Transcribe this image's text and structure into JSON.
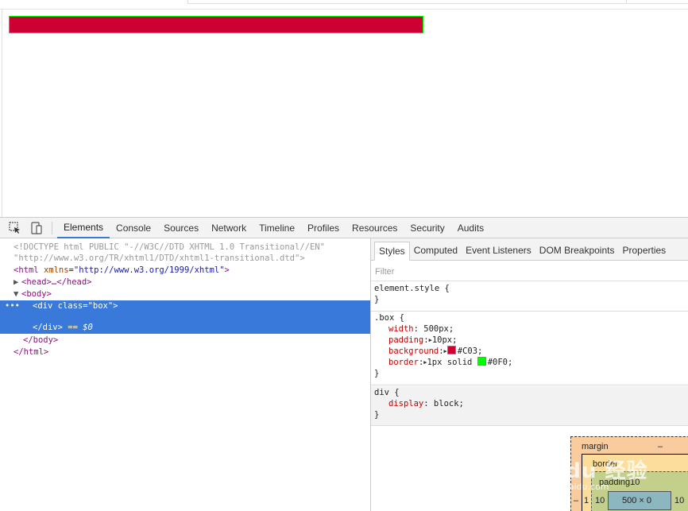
{
  "devtools": {
    "tabs": [
      "Elements",
      "Console",
      "Sources",
      "Network",
      "Timeline",
      "Profiles",
      "Resources",
      "Security",
      "Audits"
    ],
    "active_tab": "Elements",
    "icons": [
      "inspect-element-icon",
      "device-mode-icon"
    ]
  },
  "demo": {
    "box_background": "#cc0033",
    "box_border": "#00ff00"
  },
  "elements": {
    "doctype_1": "<!DOCTYPE html PUBLIC \"-//W3C//DTD XHTML 1.0 Transitional//EN\"",
    "doctype_2": "\"http://www.w3.org/TR/xhtml1/DTD/xhtml1-transitional.dtd\">",
    "html_open": "<html",
    "html_attr": "xmlns",
    "html_val": "\"http://www.w3.org/1999/xhtml\"",
    "html_close": ">",
    "head": "<head>…</head>",
    "body_open": "<body>",
    "div_open_tag": "<div",
    "div_attr": "class",
    "div_val": "\"box\"",
    "div_open_close": ">",
    "div_close": "</div>",
    "div_marker": "== $0",
    "body_close": "</body>",
    "html_end": "</html>",
    "dots": "•••"
  },
  "styles": {
    "subtabs": [
      "Styles",
      "Computed",
      "Event Listeners",
      "DOM Breakpoints",
      "Properties"
    ],
    "active_subtab": "Styles",
    "filter_placeholder": "Filter",
    "element_style_open": "element.style {",
    "close_brace": "}",
    "box_selector": ".box {",
    "width_name": "width",
    "width_value": "500px;",
    "padding_name": "padding",
    "padding_value": "10px;",
    "background_name": "background",
    "background_value": "#C03;",
    "background_color": "#cc0033",
    "border_name": "border",
    "border_value_prefix": "1px solid",
    "border_value_color": "#0F0;",
    "border_color": "#00ff00",
    "div_selector": "div {",
    "display_name": "display",
    "display_value": "block;"
  },
  "box_model": {
    "margin_label": "margin",
    "margin_value": "–",
    "border_label": "border",
    "border_left_value": "1",
    "margin_left_value": "–",
    "padding_label": "padding10",
    "padding_left": "10",
    "padding_right": "10",
    "content": "500 × 0"
  },
  "watermark": {
    "main": "Baidu 经验",
    "sub": "jingyan.baidu.com"
  }
}
